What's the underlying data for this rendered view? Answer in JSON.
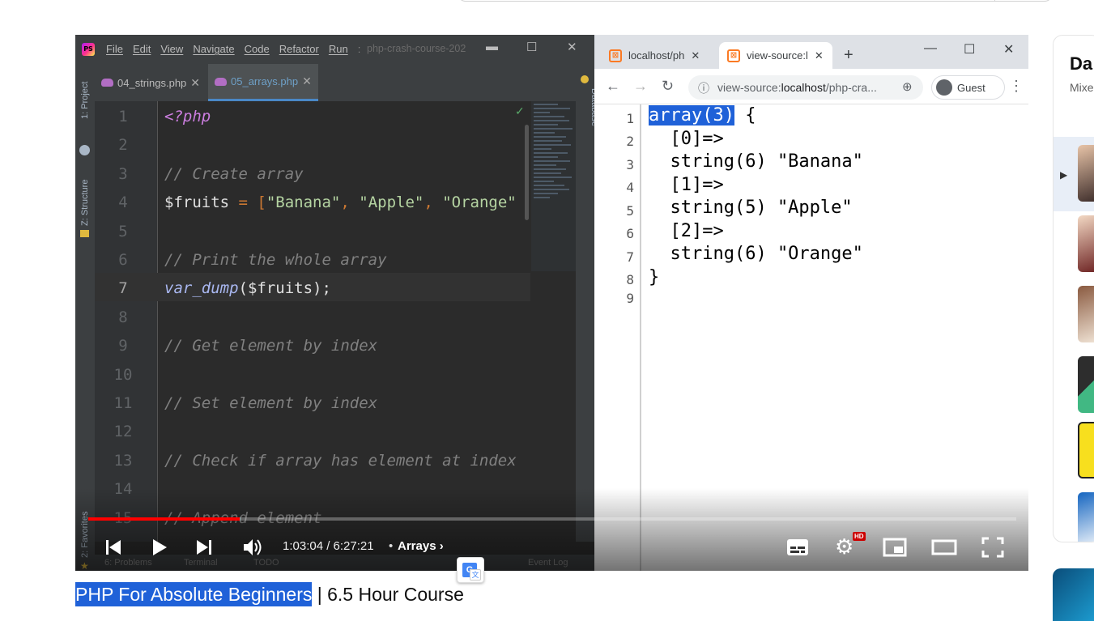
{
  "ide": {
    "logo": "PS",
    "menu": [
      "File",
      "Edit",
      "View",
      "Navigate",
      "Code",
      "Refactor",
      "Run"
    ],
    "menu_more": ":",
    "project_title": "php-crash-course-202",
    "tabs": [
      {
        "label": "04_strings.php",
        "active": false
      },
      {
        "label": "05_arrays.php",
        "active": true
      }
    ],
    "left_panels": [
      "1: Project",
      "Z: Structure",
      "2: Favorites"
    ],
    "right_panel": "Database",
    "lines": [
      {
        "n": "1",
        "text": "<?php"
      },
      {
        "n": "2",
        "text": ""
      },
      {
        "n": "3",
        "text": "// Create array"
      },
      {
        "n": "4",
        "var": "$fruits",
        "op": " = [",
        "s1": "\"Banana\"",
        "s2": "\"Apple\"",
        "s3": "\"Orange\""
      },
      {
        "n": "5",
        "text": ""
      },
      {
        "n": "6",
        "text": "// Print the whole array"
      },
      {
        "n": "7",
        "fn": "var_dump",
        "args": "($fruits);"
      },
      {
        "n": "8",
        "text": ""
      },
      {
        "n": "9",
        "text": "// Get element by index"
      },
      {
        "n": "10",
        "text": ""
      },
      {
        "n": "11",
        "text": "// Set element by index"
      },
      {
        "n": "12",
        "text": ""
      },
      {
        "n": "13",
        "text": "// Check if array has element at index"
      },
      {
        "n": "14",
        "text": ""
      },
      {
        "n": "15",
        "text": "// Append element"
      }
    ],
    "status": {
      "problems": "6: Problems",
      "terminal": "Terminal",
      "todo": "TODO",
      "event_log": "Event Log"
    }
  },
  "browser": {
    "tabs": [
      {
        "label": "localhost/ph",
        "active": false
      },
      {
        "label": "view-source:l",
        "active": true
      }
    ],
    "new_tab": "+",
    "url_prefix": "view-source:",
    "url_host": "localhost",
    "url_rest": "/php-cra...",
    "profile": "Guest",
    "source_lines": [
      {
        "n": "1",
        "hl": "array(3)",
        "text": " {"
      },
      {
        "n": "2",
        "text": "  [0]=>"
      },
      {
        "n": "3",
        "text": "  string(6) \"Banana\""
      },
      {
        "n": "4",
        "text": "  [1]=>"
      },
      {
        "n": "5",
        "text": "  string(5) \"Apple\""
      },
      {
        "n": "6",
        "text": "  [2]=>"
      },
      {
        "n": "7",
        "text": "  string(6) \"Orange\""
      },
      {
        "n": "8",
        "text": "}"
      },
      {
        "n": "9",
        "text": ""
      }
    ]
  },
  "player": {
    "current_time": "1:03:04",
    "duration": "6:27:21",
    "time_display": "1:03:04 / 6:27:21",
    "chapter": "Arrays",
    "progress_fraction": 0.163,
    "hd_label": "HD",
    "accent": "#ff0000"
  },
  "video": {
    "title_highlight": "PHP For Absolute Beginners",
    "title_rest": " | 6.5 Hour Course"
  },
  "sidebar": {
    "title": "Da",
    "subtitle": "Mixe"
  },
  "colors": {
    "ide_bg": "#2b2b2b",
    "selection": "#1f61d8"
  }
}
